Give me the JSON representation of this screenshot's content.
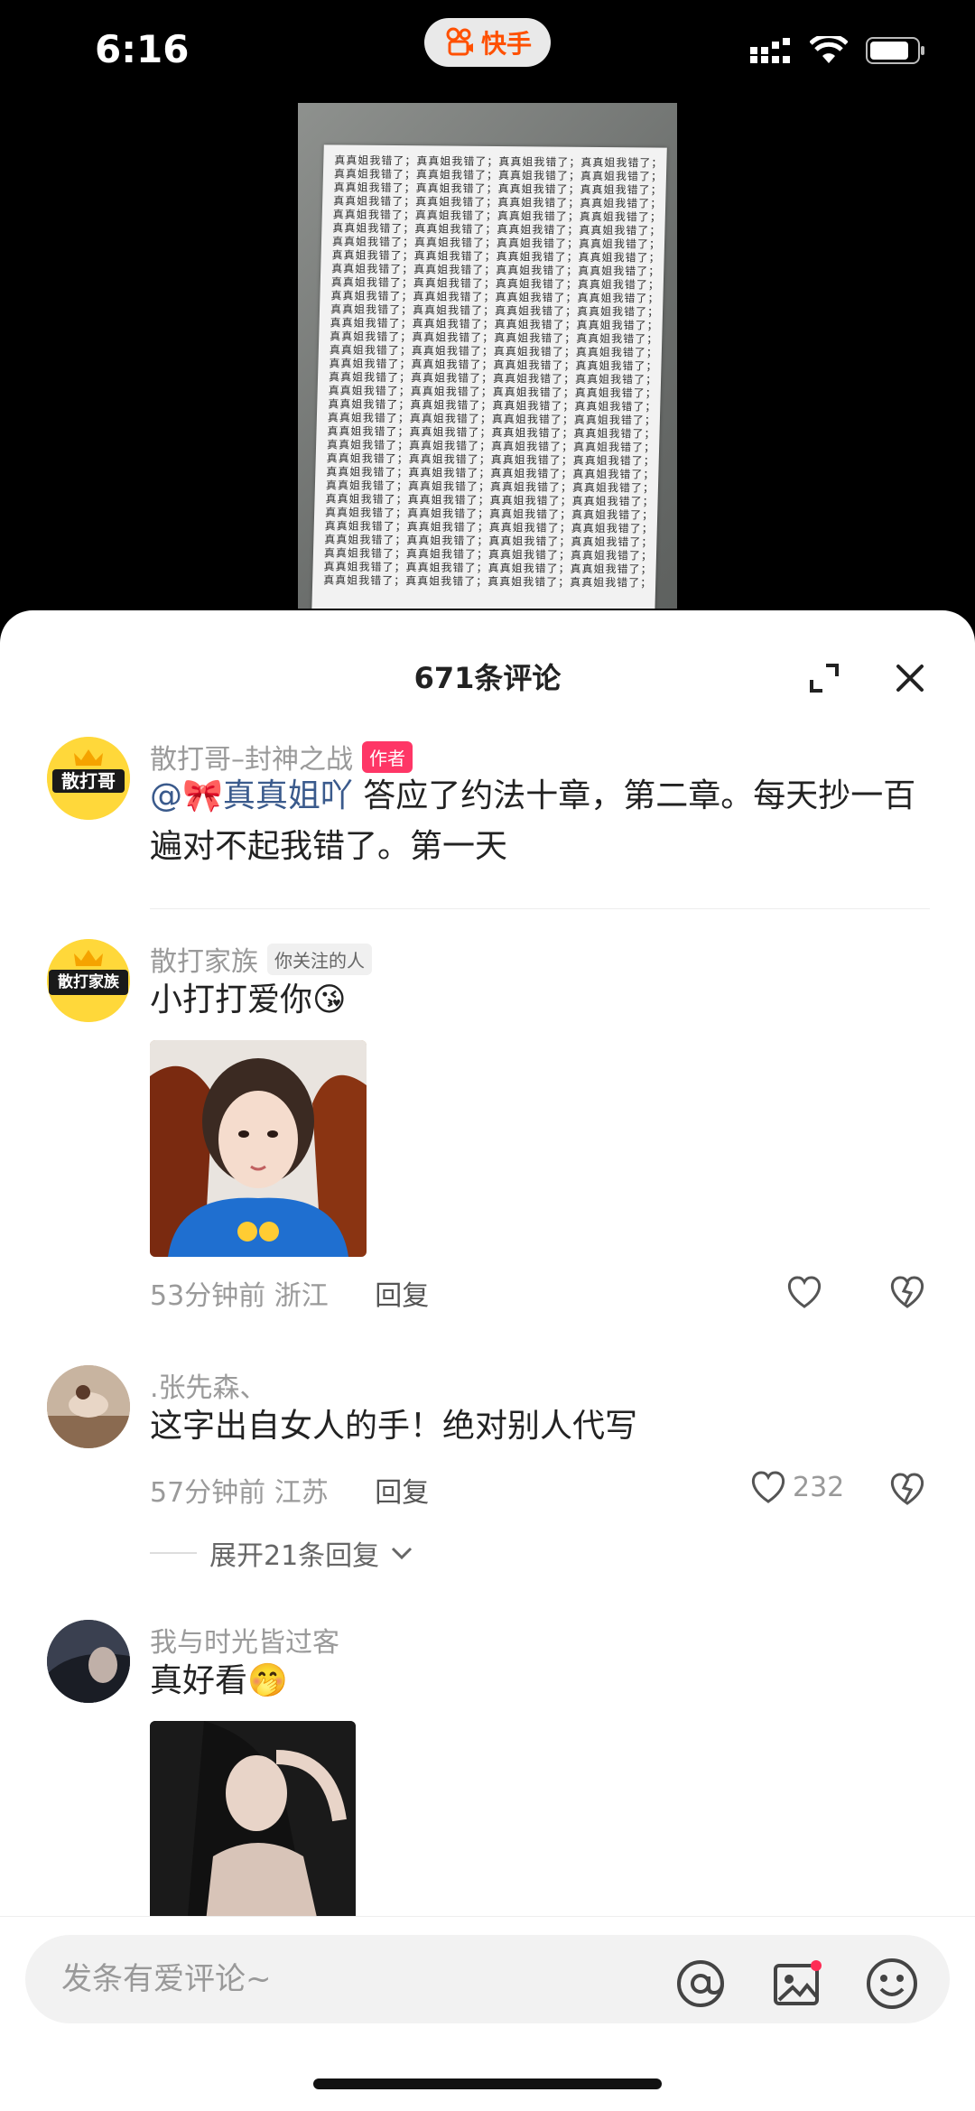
{
  "status_bar": {
    "time": "6:16",
    "app_name": "快手"
  },
  "video": {
    "paper_text": "真真姐我错了；真真姐我错了；真真姐我错了；真真姐我错了；"
  },
  "sheet": {
    "title": "671条评论",
    "icons": {
      "expand": "expand-icon",
      "close": "close-icon"
    }
  },
  "comments": [
    {
      "username": "散打哥–封神之战",
      "tag": "作者",
      "avatar_text": "散打哥",
      "mention": "@🎀真真姐吖",
      "text": " 答应了约法十章，第二章。每天抄一百遍对不起我错了。第一天"
    },
    {
      "username": "散打家族",
      "tag": "你关注的人",
      "avatar_text": "散打家族",
      "text": "小打打爱你😘",
      "time": "53分钟前",
      "location": "浙江",
      "reply_label": "回复"
    },
    {
      "username": ".张先森、",
      "text": "这字出自女人的手！绝对别人代写",
      "time": "57分钟前",
      "location": "江苏",
      "reply_label": "回复",
      "likes": "232",
      "expand_label": "展开21条回复"
    },
    {
      "username": "我与时光皆过客",
      "text": "真好看🤭"
    }
  ],
  "input": {
    "placeholder": "发条有爱评论~"
  },
  "colors": {
    "brand": "#ff5000",
    "author_tag": "#fe3666",
    "mention": "#3a5a8c"
  }
}
